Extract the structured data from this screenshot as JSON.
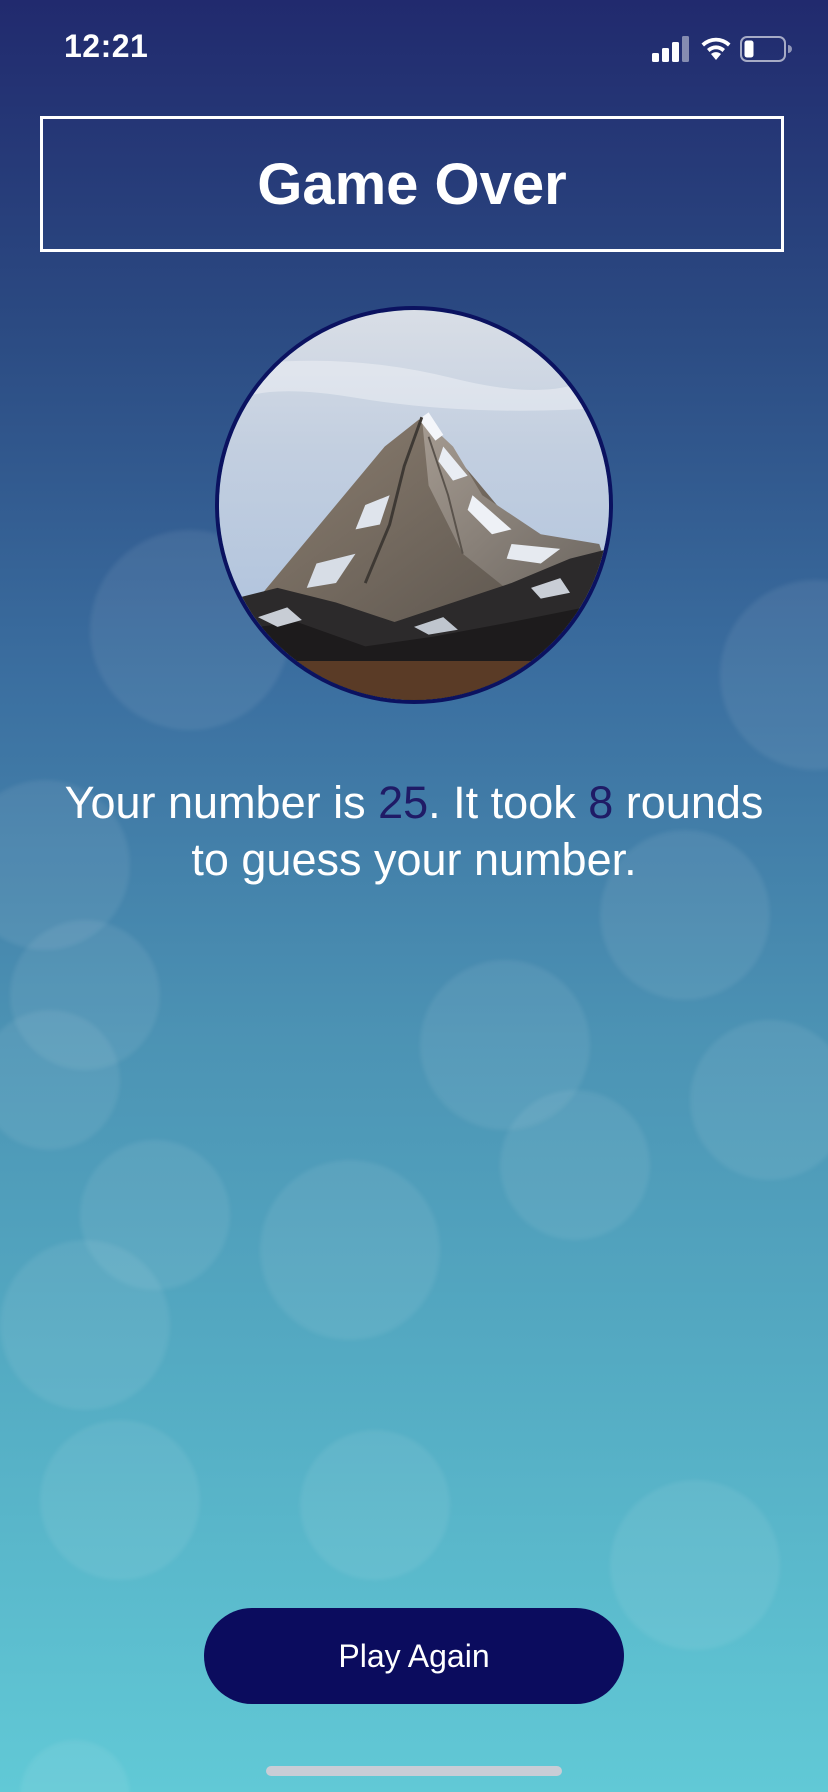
{
  "status_bar": {
    "time": "12:21",
    "icons": [
      "signal-icon",
      "wifi-icon",
      "battery-icon"
    ]
  },
  "title": "Game Over",
  "image": {
    "subject": "mountain-peak-image"
  },
  "summary": {
    "prefix": "Your number is ",
    "user_number": "25",
    "middle": ". It took ",
    "rounds": "8",
    "suffix": " rounds to guess your number."
  },
  "button": {
    "label": "Play Again"
  },
  "colors": {
    "gradient_top": "#212a6e",
    "gradient_bottom": "#61c9d6",
    "button_bg": "#0b0c5e",
    "highlight_number": "#1f1b66",
    "image_border": "#0b1260"
  }
}
